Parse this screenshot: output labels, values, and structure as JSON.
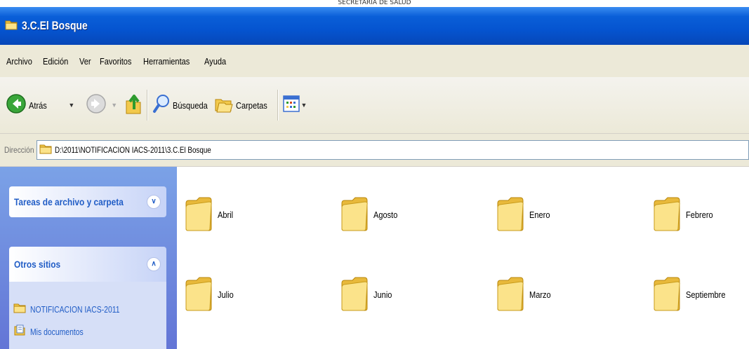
{
  "caption": "SECRETARIA DE SALUD",
  "window": {
    "title": "3.C.El Bosque"
  },
  "menu": [
    "Archivo",
    "Edición",
    "Ver",
    "Favoritos",
    "Herramientas",
    "Ayuda"
  ],
  "toolbar": {
    "back_label": "Atrás",
    "search_label": "Búsqueda",
    "folders_label": "Carpetas"
  },
  "address": {
    "label": "Dirección",
    "value": "D:\\2011\\NOTIFICACION IACS-2011\\3.C.El Bosque"
  },
  "sidebar": {
    "panels": [
      {
        "title": "Tareas de archivo y carpeta",
        "expanded": false
      },
      {
        "title": "Otros sitios",
        "expanded": true,
        "links": [
          "NOTIFICACION IACS-2011",
          "Mis documentos"
        ]
      }
    ]
  },
  "folders": [
    "Abril",
    "Agosto",
    "Enero",
    "Febrero",
    "Julio",
    "Junio",
    "Marzo",
    "Septiembre"
  ],
  "colors": {
    "titlebar": "#0554d0",
    "sidebar_bg": "#7ba2e7",
    "link": "#215dc6",
    "folder": "#f7d86b"
  }
}
